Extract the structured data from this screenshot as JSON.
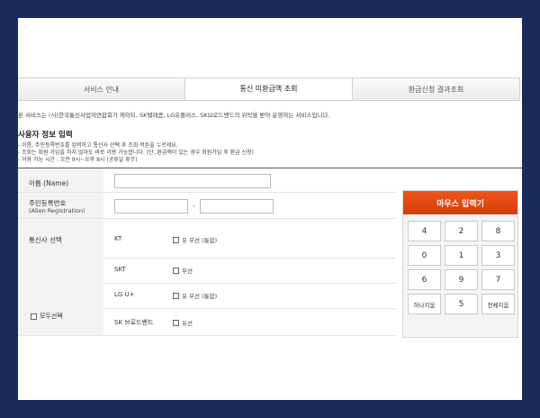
{
  "tabs": [
    {
      "label": "서비스 안내",
      "active": false
    },
    {
      "label": "통신 미환급액 조회",
      "active": true
    },
    {
      "label": "환급신청 결과조회",
      "active": false
    }
  ],
  "intro_text": "본 서비스는 (사)한국통신사업자연합회가 케이티, SK텔레콤, LG유플러스, SK브로드밴드의 위탁을 받아 운영하는 서비스입니다.",
  "section": {
    "title": "사용자 정보 입력",
    "notes": [
      "- 이름, 주민등록번호를 입력하고 통신사 선택 후 조회 버튼을 누르세요.",
      "- 조회는 회원 가입을 하지 않아도 바로 이용 가능합니다. (단, 환급액이 있는 경우 회원가입 후 환급 신청)",
      "- 이용 가능 시간 : 오전 9시~오후 8시 (공휴일 휴무)"
    ]
  },
  "form": {
    "name_label": "이름 (Name)",
    "name_value": "",
    "rrn_label": "주민등록번호",
    "rrn_sub_label": "(Alien Registration)",
    "rrn_first_value": "",
    "rrn_second_value": "",
    "rrn_separator": "-",
    "carrier_label": "통신사 선택",
    "select_all_label": "모두선택",
    "carriers": [
      {
        "name": "KT",
        "option": "유 무선 (통합)"
      },
      {
        "name": "SKT",
        "option": "무선"
      },
      {
        "name": "LG U+",
        "option": "유 무선 (통합)"
      },
      {
        "name": "SK 브로드밴드",
        "option": "유선"
      }
    ]
  },
  "keypad": {
    "title": "마우스 입력기",
    "keys": [
      "4",
      "2",
      "8",
      "0",
      "1",
      "3",
      "6",
      "9",
      "7",
      "하나지움",
      "5",
      "전체지움"
    ]
  },
  "colors": {
    "outer_background": "#1a2b5a",
    "keypad_header": "#e8481a"
  }
}
